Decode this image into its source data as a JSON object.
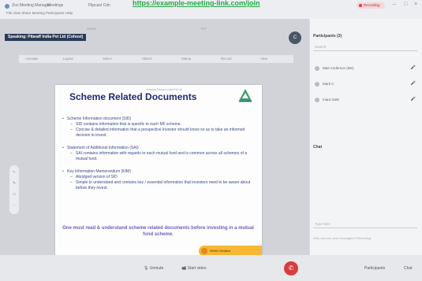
{
  "browser": {
    "tabs": [
      "Zoo Meeting Manager",
      "Meetings",
      "Flipcast Cdn"
    ],
    "banner": "https://example-meeting-link.com/join",
    "menu": "File  View  Share  Meeting  Participants  Help",
    "rec_label": "Recording"
  },
  "speaking": "Speaking: Pibeaff India Pvt Ltd (Cohost)",
  "top_toolbar": [
    "Share",
    "",
    "",
    "TAT"
  ],
  "avatar_initials": "C",
  "ppt_toolbar": [
    "Annotate",
    "Layout",
    "Select",
    "Sketch",
    "Stamp",
    "Record",
    "View"
  ],
  "slide": {
    "company": "Vimeep Privuec India Pvt Ltd",
    "title": "Scheme Related Documents",
    "sections": [
      {
        "bullet": "Scheme Information document (SID)",
        "subs": [
          "SID contains information that is specific to each MF scheme.",
          "Concise & detailed information that a prospective investor should know so as to take an informed decision to invest."
        ]
      },
      {
        "bullet": "Statement of Additional Information (SAI)",
        "subs": [
          "SAI contains information with regards to each mutual fund and is common across all schemes of a mutual fund."
        ]
      },
      {
        "bullet": "Key Information Memorandum (KIM)",
        "subs": [
          "Abridged version of SID",
          "Simple to understand and contains key / essential information that investors need to be aware about before they invest."
        ]
      }
    ],
    "conclusion": "One must read & understand scheme related documents before investing in a mutual fund scheme.",
    "nism": "NISM Certified"
  },
  "panel": {
    "header": "Participants (3)",
    "search_placeholder": "Search",
    "participants": [
      {
        "name": "Mae Anderson (Me)"
      },
      {
        "name": "Mark C"
      },
      {
        "name": "Inara Gale"
      }
    ],
    "chat_label": "Chat",
    "chat_placeholder": "Type here",
    "chat_hint": "Who can see your messages? Recording"
  },
  "bottombar": {
    "unmute": "Unmute",
    "start_video": "Start video",
    "participants": "Participants",
    "chat": "Chat"
  },
  "colors": {
    "slide_title": "#1e2a6e",
    "conclusion": "#6a5fbf",
    "leave": "#d93c3c",
    "banner": "#25a846"
  }
}
